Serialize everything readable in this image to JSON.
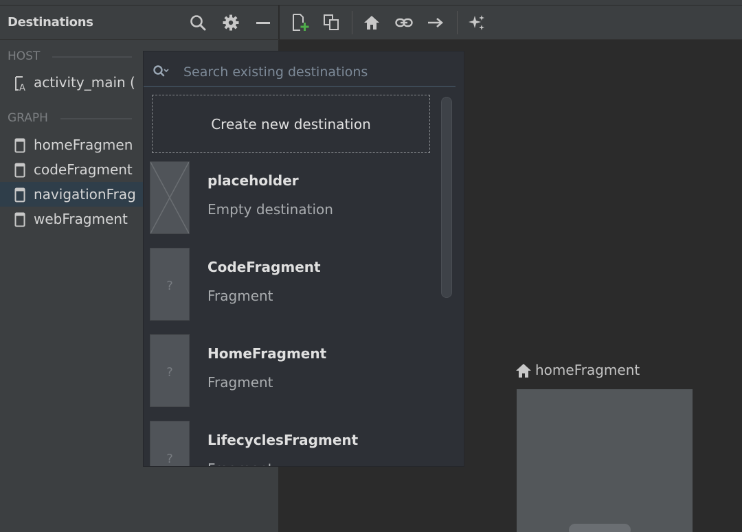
{
  "panel": {
    "title": "Destinations",
    "host_label": "HOST",
    "graph_label": "GRAPH",
    "host_items": [
      {
        "label": "activity_main (",
        "icon": "layout-icon"
      }
    ],
    "graph_items": [
      {
        "label": "homeFragmen",
        "icon": "fragment-icon"
      },
      {
        "label": "codeFragment",
        "icon": "fragment-icon"
      },
      {
        "label": "navigationFrag",
        "icon": "fragment-icon",
        "selected": true
      },
      {
        "label": "webFragment",
        "icon": "fragment-icon"
      }
    ]
  },
  "toolbar": {
    "icons": [
      "new-destination-icon",
      "nested-graph-icon",
      "home-icon",
      "deep-link-icon",
      "action-arrow-icon",
      "auto-arrange-icon"
    ]
  },
  "popup": {
    "search_placeholder": "Search existing destinations",
    "create_label": "Create new destination",
    "destinations": [
      {
        "name": "placeholder",
        "type": "Empty destination",
        "thumb": "placeholder-x"
      },
      {
        "name": "CodeFragment",
        "type": "Fragment",
        "thumb": "?"
      },
      {
        "name": "HomeFragment",
        "type": "Fragment",
        "thumb": "?"
      },
      {
        "name": "LifecyclesFragment",
        "type": "Fragment",
        "thumb": "?"
      }
    ]
  },
  "canvas": {
    "start_node_label": "homeFragment"
  },
  "colors": {
    "panel_bg": "#3c3f41",
    "canvas_bg": "#2b2b2b",
    "popup_bg": "#2d3036",
    "selection": "#2f3e4a",
    "accent_green": "#4fae4a"
  }
}
